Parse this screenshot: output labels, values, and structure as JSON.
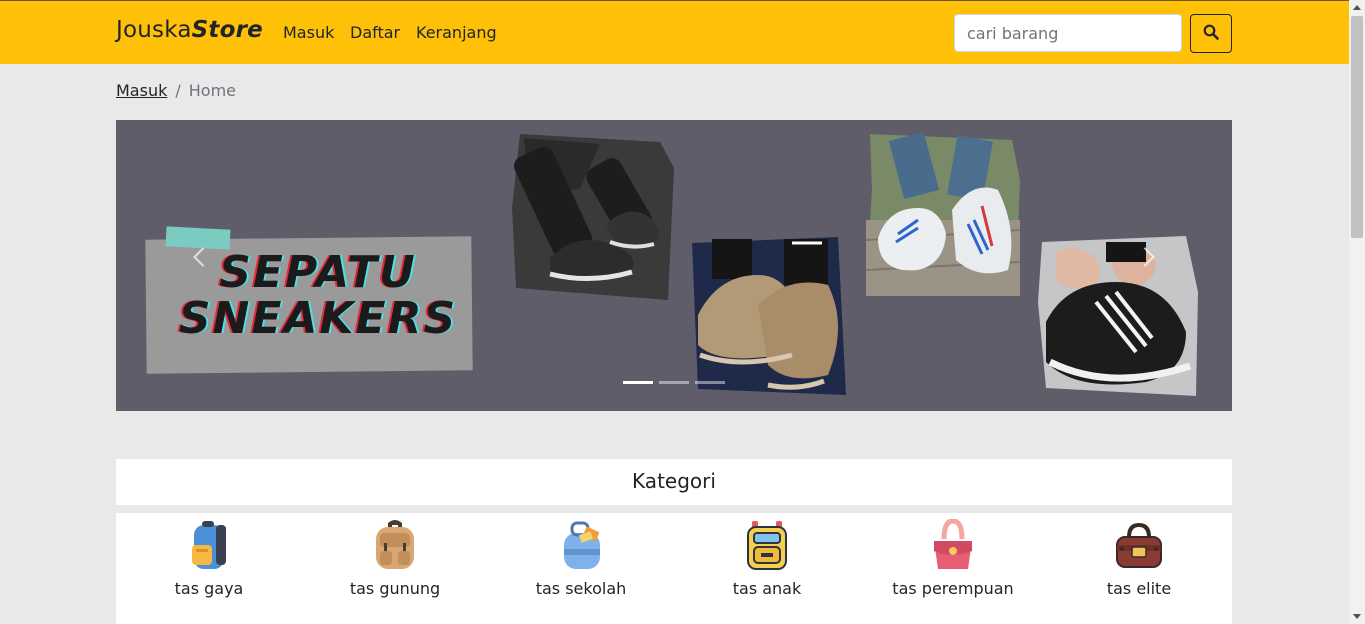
{
  "navbar": {
    "brand_prefix": "Jouska",
    "brand_suffix": "Store",
    "links": [
      "Masuk",
      "Daftar",
      "Keranjang"
    ],
    "search_placeholder": "cari barang",
    "search_icon": "search-icon",
    "bg_color": "#ffc107"
  },
  "breadcrumb": {
    "link": "Masuk",
    "separator": "/",
    "active": "Home"
  },
  "carousel": {
    "banner_line1": "SEPATU",
    "banner_line2": "SNEAKERS",
    "slide_count": 3,
    "active_slide": 1,
    "prev_icon": "chevron-left-icon",
    "next_icon": "chevron-right-icon"
  },
  "categories": {
    "title": "Kategori",
    "items": [
      {
        "label": "tas gaya",
        "icon": "backpack-blue-icon"
      },
      {
        "label": "tas gunung",
        "icon": "hiking-backpack-icon"
      },
      {
        "label": "tas sekolah",
        "icon": "school-bag-icon"
      },
      {
        "label": "tas anak",
        "icon": "kids-backpack-icon"
      },
      {
        "label": "tas perempuan",
        "icon": "handbag-icon"
      },
      {
        "label": "tas elite",
        "icon": "luxury-bag-icon"
      }
    ]
  }
}
